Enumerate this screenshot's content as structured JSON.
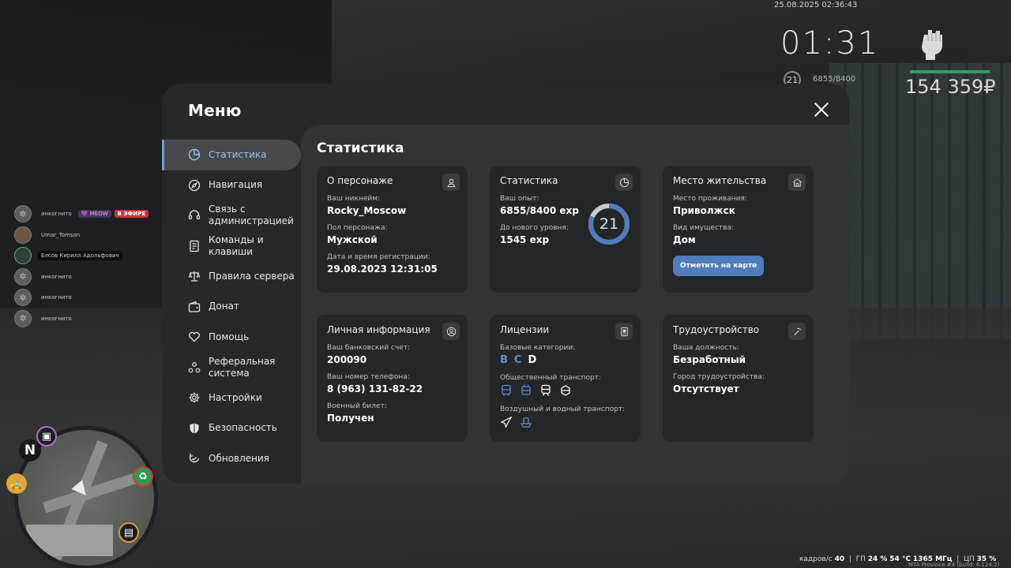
{
  "hud": {
    "date": "25.08.2025 02:36:43",
    "time": "01:31",
    "level": "21",
    "exp": "6855/8400",
    "money": "154 359₽",
    "health_color": "#2fa360"
  },
  "voice_chat": [
    {
      "name": "инкогнито",
      "tag": "💜 MEOW",
      "tag2": "В ЭФИРЕ"
    },
    {
      "name": "Umar_Tomson",
      "tag": "",
      "tag2": ""
    },
    {
      "name": "Елсов Кирилл Адольфович",
      "tag": "",
      "tag2": ""
    },
    {
      "name": "инкогнито",
      "tag": "",
      "tag2": ""
    },
    {
      "name": "инкогнито",
      "tag": "",
      "tag2": ""
    },
    {
      "name": "инкогнито",
      "tag": "",
      "tag2": ""
    }
  ],
  "minimap": {
    "north": "N"
  },
  "perf": {
    "fps_label": "кадров/с",
    "fps": "40",
    "gpu_label": "ГП",
    "gpu_load": "24 %",
    "gpu_temp": "54 °C",
    "gpu_freq": "1365 МГц",
    "cpu_label": "ЦП",
    "cpu_load": "35 %",
    "build": "MTA Province #4 (build: 6.124.2)"
  },
  "menu": {
    "title": "Меню",
    "accent": "#6ea0de",
    "nav": [
      {
        "label": "Статистика",
        "icon": "pie-chart-icon"
      },
      {
        "label": "Навигация",
        "icon": "compass-icon"
      },
      {
        "label": "Связь с администрацией",
        "icon": "headset-icon"
      },
      {
        "label": "Команды и клавиши",
        "icon": "document-icon"
      },
      {
        "label": "Правила сервера",
        "icon": "scales-icon"
      },
      {
        "label": "Донат",
        "icon": "wallet-icon"
      },
      {
        "label": "Помощь",
        "icon": "heart-hands-icon"
      },
      {
        "label": "Реферальная система",
        "icon": "people-network-icon"
      },
      {
        "label": "Настройки",
        "icon": "gear-icon"
      },
      {
        "label": "Безопасность",
        "icon": "shield-icon"
      },
      {
        "label": "Обновления",
        "icon": "refresh-check-icon"
      }
    ],
    "content_title": "Статистика",
    "cards": {
      "character": {
        "title": "О персонаже",
        "nickname_label": "Ваш никнейм:",
        "nickname": "Rocky_Moscow",
        "gender_label": "Пол персонажа:",
        "gender": "Мужской",
        "reg_label": "Дата и время регистрации:",
        "reg_date": "29.08.2023 12:31:05"
      },
      "stats": {
        "title": "Статистика",
        "exp_label": "Ваш опыт:",
        "exp": "6855/8400 exp",
        "next_label": "До нового уровня:",
        "next": "1545 exp",
        "level": "21",
        "progress": 0.816
      },
      "residence": {
        "title": "Место жительства",
        "place_label": "Место проживания:",
        "place": "Приволжск",
        "property_label": "Вид имущества:",
        "property": "Дом",
        "button": "Отметить на карте"
      },
      "personal": {
        "title": "Личная информация",
        "bank_label": "Ваш банковский счет:",
        "bank": "200090",
        "phone_label": "Ваш номер телефона:",
        "phone": "8 (963) 131-82-22",
        "military_label": "Военный билет:",
        "military": "Получен"
      },
      "licenses": {
        "title": "Лицензии",
        "base_label": "Базовые категории:",
        "categories": [
          "B",
          "C",
          "D"
        ],
        "public_label": "Общественный транспорт:",
        "air_label": "Воздушный и водный транспорт:"
      },
      "employment": {
        "title": "Трудоустройство",
        "position_label": "Ваша должность:",
        "position": "Безработный",
        "city_label": "Город трудоустройства:",
        "city": "Отсутствует"
      }
    }
  }
}
